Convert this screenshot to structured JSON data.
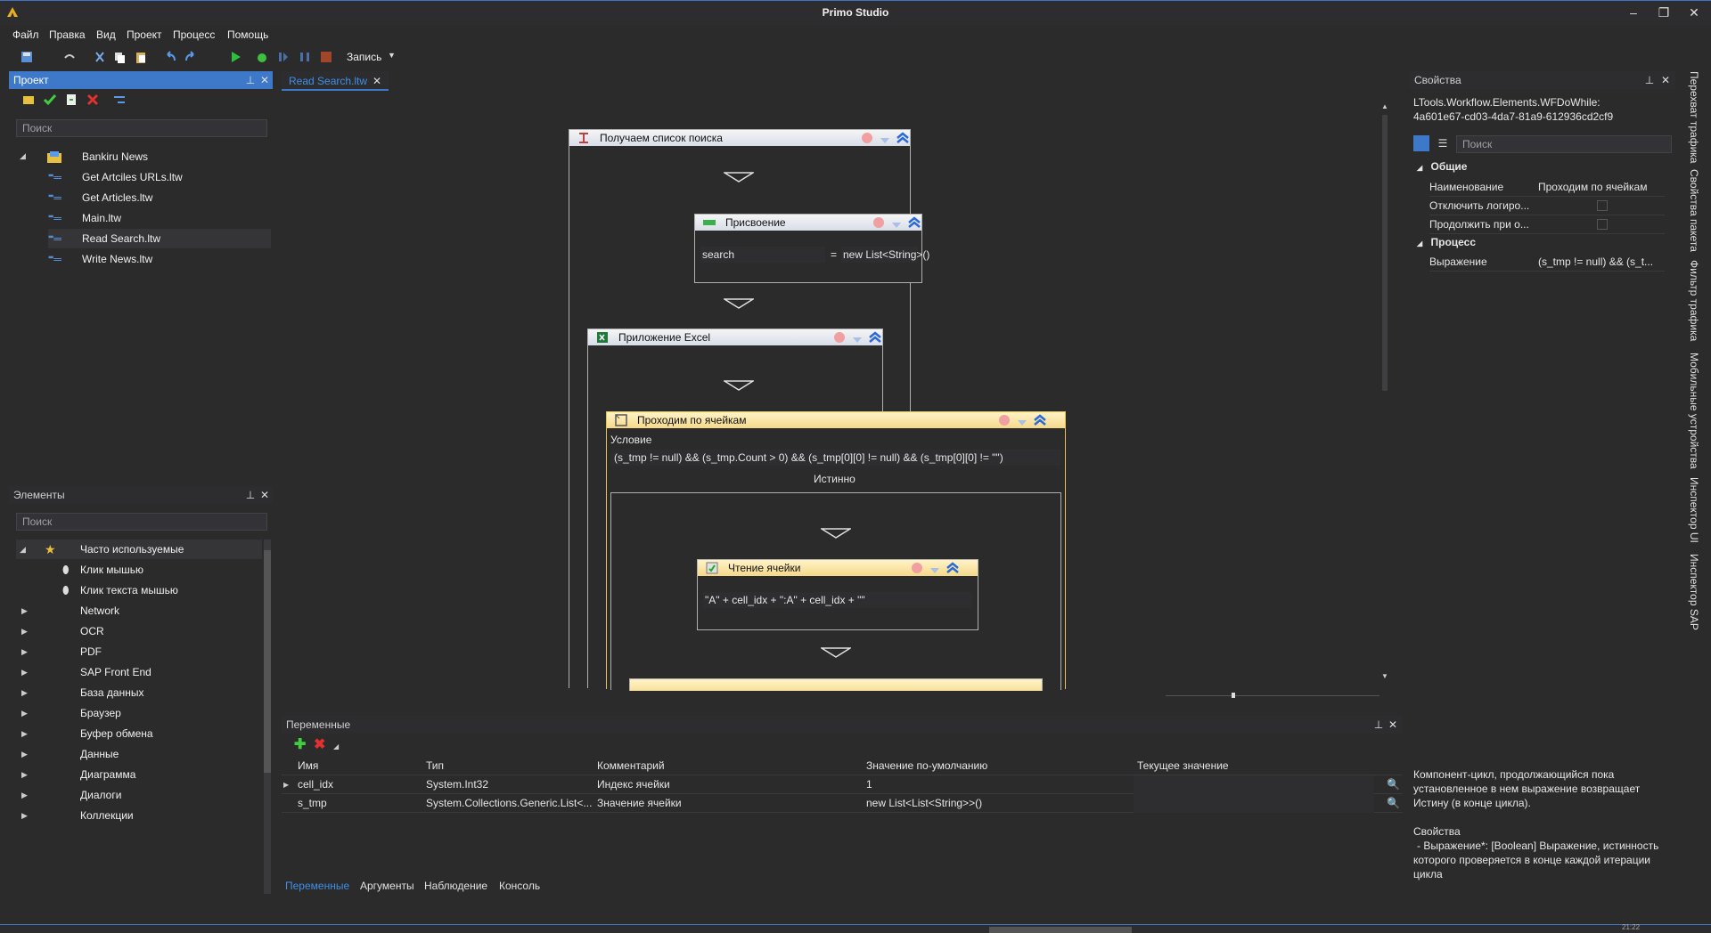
{
  "window": {
    "title": "Primo Studio"
  },
  "menu": [
    "Файл",
    "Правка",
    "Вид",
    "Проект",
    "Процесс",
    "Помощь"
  ],
  "toolbar": {
    "record_label": "Запись"
  },
  "project_panel": {
    "title": "Проект",
    "search_placeholder": "Поиск",
    "root": "Bankiru News",
    "files": [
      "Get Artciles URLs.ltw",
      "Get Articles.ltw",
      "Main.ltw",
      "Read Search.ltw",
      "Write News.ltw"
    ]
  },
  "elements_panel": {
    "title": "Элементы",
    "search_placeholder": "Поиск",
    "items": [
      "Часто используемые",
      "Клик мышью",
      "Клик текста мышью",
      "Network",
      "OCR",
      "PDF",
      "SAP Front End",
      "База данных",
      "Браузер",
      "Буфер обмена",
      "Данные",
      "Диаграмма",
      "Диалоги",
      "Коллекции"
    ]
  },
  "document_tab": {
    "label": "Read Search.ltw"
  },
  "workflow": {
    "outer_title": "Получаем список поиска",
    "assign": {
      "title": "Присвоение",
      "left": "search",
      "op": "=",
      "right": "new List<String>()"
    },
    "excel_title": "Приложение Excel",
    "loop": {
      "title": "Проходим по ячейкам",
      "condition_label": "Условие",
      "condition": "(s_tmp != null) && (s_tmp.Count > 0) && (s_tmp[0][0] != null) && (s_tmp[0][0] != \"\")",
      "true_label": "Истинно"
    },
    "read_cell": {
      "title": "Чтение ячейки",
      "expr": "\"A\" + cell_idx + \":A\" + cell_idx + \"\""
    }
  },
  "variables_panel": {
    "title": "Переменные",
    "columns": [
      "Имя",
      "Тип",
      "Комментарий",
      "Значение по-умолчанию",
      "Текущее значение"
    ],
    "rows": [
      {
        "name": "cell_idx",
        "type": "System.Int32",
        "comment": "Индекс ячейки",
        "default": "1",
        "current": ""
      },
      {
        "name": "s_tmp",
        "type": "System.Collections.Generic.List<...",
        "comment": "Значение ячейки",
        "default": "new List<List<String>>()",
        "current": ""
      }
    ],
    "tabs": [
      "Переменные",
      "Аргументы",
      "Наблюдение",
      "Консоль"
    ]
  },
  "properties_panel": {
    "title": "Свойства",
    "type_name": "LTools.Workflow.Elements.WFDoWhile:",
    "guid": "4a601e67-cd03-4da7-81a9-612936cd2cf9",
    "search_placeholder": "Поиск",
    "cat_general": "Общие",
    "props_general": [
      {
        "name": "Наименование",
        "value": "Проходим по ячейкам"
      },
      {
        "name": "Отключить логиро...",
        "value": ""
      },
      {
        "name": "Продолжить при о...",
        "value": ""
      }
    ],
    "cat_process": "Процесс",
    "props_process": [
      {
        "name": "Выражение",
        "value": "(s_tmp != null) && (s_t..."
      }
    ],
    "desc_line1": "Компонент-цикл, продолжающийся пока",
    "desc_line2": "установленное в нем выражение возвращает",
    "desc_line3": "Истину (в конце цикла).",
    "desc_props": "Свойства",
    "desc_expr1": "- Выражение*: [Boolean] Выражение, истинность",
    "desc_expr2": "которого проверяется в конце каждой итерации",
    "desc_expr3": "цикла"
  },
  "side_tabs": [
    "Перехват трафика",
    "Свойства пакета",
    "Фильтр трафика",
    "Мобильные устройства",
    "Инспектор UI",
    "Инспектор SAP"
  ],
  "status": {
    "time": "21:22"
  },
  "colors": {
    "accent": "#3e79c9",
    "background": "#2b2b2b",
    "panel": "#2d2d30",
    "selected_activity": "#e8c050"
  }
}
